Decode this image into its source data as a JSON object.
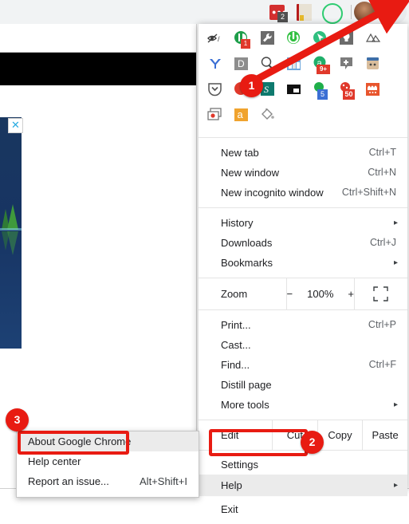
{
  "browser": {
    "toolbar": {
      "star_icon": "bookmark-star-icon",
      "extension_badge_count": "2",
      "avatar": "profile-avatar",
      "menu_icon": "three-dot-menu-icon"
    },
    "page": {
      "hamburger": "hamburger-menu-icon",
      "ad_close_label": "✕"
    }
  },
  "menu": {
    "extension_rows": [
      [
        {
          "name": "adblock-eye-icon",
          "badge": ""
        },
        {
          "name": "green-circle-extension-icon",
          "badge": "1"
        },
        {
          "name": "wrench-extension-icon",
          "badge": ""
        },
        {
          "name": "green-thumb-extension-icon",
          "badge": ""
        },
        {
          "name": "green-cursor-extension-icon",
          "badge": ""
        },
        {
          "name": "lightbulb-extension-icon",
          "badge": ""
        },
        {
          "name": "mountains-extension-icon",
          "badge": ""
        }
      ],
      [
        {
          "name": "blue-y-extension-icon",
          "badge": ""
        },
        {
          "name": "letter-d-extension-icon",
          "badge": ""
        },
        {
          "name": "magnifier-extension-icon",
          "badge": ""
        },
        {
          "name": "city-extension-icon",
          "badge": ""
        },
        {
          "name": "green-a-extension-icon",
          "badge": "9+"
        },
        {
          "name": "gray-plus-extension-icon",
          "badge": ""
        },
        {
          "name": "robot-extension-icon",
          "badge": ""
        }
      ],
      [
        {
          "name": "pocket-extension-icon",
          "badge": ""
        },
        {
          "name": "red-circle-extension-icon",
          "badge": ""
        },
        {
          "name": "teal-s-extension-icon",
          "badge": ""
        },
        {
          "name": "picture-in-picture-extension-icon",
          "badge": ""
        },
        {
          "name": "green-bubble-extension-icon",
          "badge": "5"
        },
        {
          "name": "red-alert-extension-icon",
          "badge": "50"
        },
        {
          "name": "flames-extension-icon",
          "badge": ""
        }
      ],
      [
        {
          "name": "window-extension-icon",
          "badge": ""
        },
        {
          "name": "amazon-extension-icon",
          "badge": ""
        },
        {
          "name": "paint-bucket-extension-icon",
          "badge": ""
        }
      ]
    ],
    "group1": [
      {
        "label": "New tab",
        "accel": "Ctrl+T",
        "arrow": ""
      },
      {
        "label": "New window",
        "accel": "Ctrl+N",
        "arrow": ""
      },
      {
        "label": "New incognito window",
        "accel": "Ctrl+Shift+N",
        "arrow": ""
      }
    ],
    "group2": [
      {
        "label": "History",
        "accel": "",
        "arrow": "▸"
      },
      {
        "label": "Downloads",
        "accel": "Ctrl+J",
        "arrow": ""
      },
      {
        "label": "Bookmarks",
        "accel": "",
        "arrow": "▸"
      }
    ],
    "zoom": {
      "label": "Zoom",
      "minus": "−",
      "value": "100%",
      "plus": "+",
      "fullscreen_icon": "fullscreen-icon"
    },
    "group3": [
      {
        "label": "Print...",
        "accel": "Ctrl+P",
        "arrow": ""
      },
      {
        "label": "Cast...",
        "accel": "",
        "arrow": ""
      },
      {
        "label": "Find...",
        "accel": "Ctrl+F",
        "arrow": ""
      },
      {
        "label": "Distill page",
        "accel": "",
        "arrow": ""
      },
      {
        "label": "More tools",
        "accel": "",
        "arrow": "▸"
      }
    ],
    "edit_row": {
      "edit": "Edit",
      "cut": "Cut",
      "copy": "Copy",
      "paste": "Paste"
    },
    "group4": [
      {
        "label": "Settings",
        "accel": "",
        "arrow": "",
        "highlighted": false
      },
      {
        "label": "Help",
        "accel": "",
        "arrow": "▸",
        "highlighted": true
      },
      {
        "label": "Exit",
        "accel": "",
        "arrow": "",
        "highlighted": false
      }
    ]
  },
  "help_submenu": [
    {
      "label": "About Google Chrome",
      "accel": "",
      "highlighted": true
    },
    {
      "label": "Help center",
      "accel": "",
      "highlighted": false
    },
    {
      "label": "Report an issue...",
      "accel": "Alt+Shift+I",
      "highlighted": false
    }
  ],
  "annotations": {
    "badge1": "1",
    "badge2": "2",
    "badge3": "3",
    "accent_color": "#e81b12"
  }
}
